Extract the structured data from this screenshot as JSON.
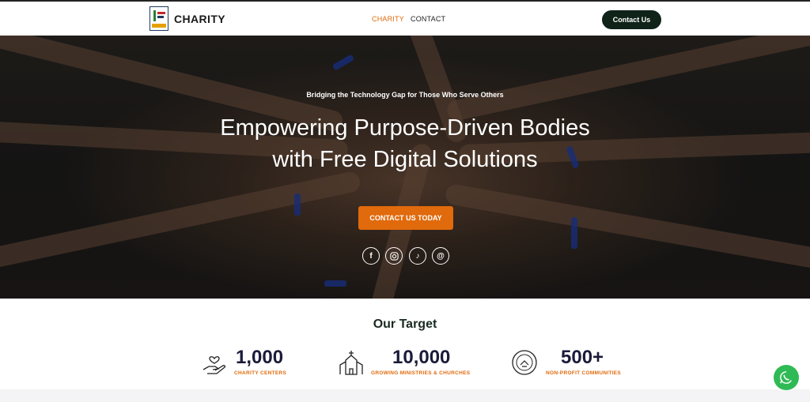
{
  "header": {
    "brand": "CHARITY",
    "nav": [
      {
        "label": "CHARITY",
        "active": true
      },
      {
        "label": "CONTACT",
        "active": false
      }
    ],
    "cta_label": "Contact Us"
  },
  "hero": {
    "kicker": "Bridging the Technology Gap for Those Who Serve Others",
    "headline_line1": "Empowering Purpose-Driven Bodies",
    "headline_line2": "with Free Digital Solutions",
    "cta_label": "CONTACT US TODAY",
    "social_icons": [
      "facebook-icon",
      "instagram-icon",
      "tiktok-icon",
      "threads-icon"
    ]
  },
  "target": {
    "title": "Our Target",
    "stats": [
      {
        "value": "1,000",
        "label": "CHARITY CENTERS",
        "icon": "heart-hand-icon"
      },
      {
        "value": "10,000",
        "label": "GROWING MINISTRIES & CHURCHES",
        "icon": "church-icon"
      },
      {
        "value": "500+",
        "label": "NON-PROFIT COMMUNITIES",
        "icon": "non-profit-icon"
      }
    ]
  },
  "colors": {
    "accent": "#e06a0c",
    "dark_button": "#0f2318",
    "whatsapp": "#2fba56"
  }
}
